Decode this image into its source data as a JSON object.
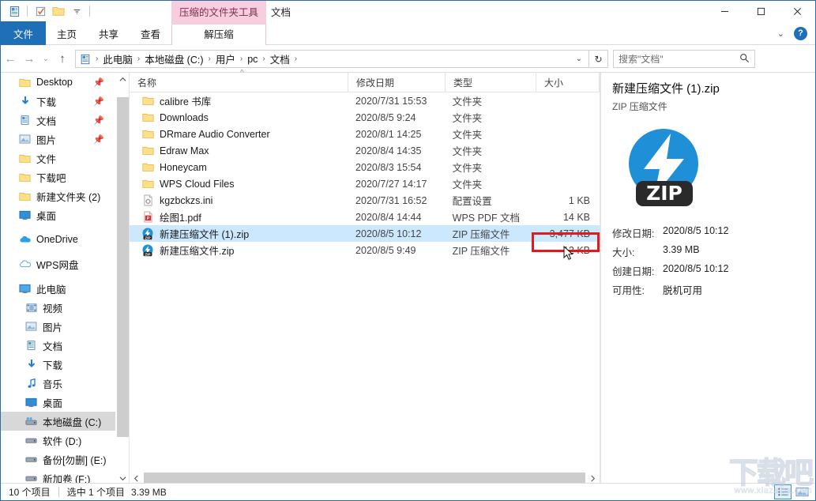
{
  "window": {
    "title": "文档",
    "contextual_tab_title": "压缩的文件夹工具",
    "minimize": "—",
    "maximize": "▢",
    "close": "✕"
  },
  "quick_access_toolbar": {
    "items": [
      {
        "name": "properties-icon",
        "glyph": "▤"
      },
      {
        "name": "new-folder-icon",
        "glyph": "▣"
      },
      {
        "name": "folder-icon",
        "glyph": "▬"
      },
      {
        "name": "customize-dropdown-icon",
        "glyph": "▼"
      }
    ]
  },
  "ribbon": {
    "tabs": [
      {
        "id": "file",
        "label": "文件"
      },
      {
        "id": "home",
        "label": "主页"
      },
      {
        "id": "share",
        "label": "共享"
      },
      {
        "id": "view",
        "label": "查看"
      },
      {
        "id": "extract",
        "label": "解压缩"
      }
    ],
    "collapse_label": "⌄",
    "help_label": "?"
  },
  "addressbar": {
    "back": "←",
    "forward": "→",
    "recent": "⌄",
    "up": "↑",
    "breadcrumbs": [
      "此电脑",
      "本地磁盘 (C:)",
      "用户",
      "pc",
      "文档"
    ],
    "separator": "›",
    "dropdown": "⌄",
    "refresh": "↻"
  },
  "search": {
    "placeholder": "搜索\"文档\"",
    "icon": "search-icon"
  },
  "sidebar": {
    "groups": [
      {
        "items": [
          {
            "label": "Desktop",
            "icon": "folder-icon",
            "pinned": true
          },
          {
            "label": "下载",
            "icon": "download-icon",
            "pinned": true
          },
          {
            "label": "文档",
            "icon": "documents-icon",
            "pinned": true
          },
          {
            "label": "图片",
            "icon": "pictures-icon",
            "pinned": true
          },
          {
            "label": "文件",
            "icon": "folder-icon",
            "pinned": false
          },
          {
            "label": "下载吧",
            "icon": "folder-icon",
            "pinned": false
          },
          {
            "label": "新建文件夹 (2)",
            "icon": "folder-icon",
            "pinned": false
          },
          {
            "label": "桌面",
            "icon": "desktop-icon",
            "pinned": false
          }
        ]
      },
      {
        "items": [
          {
            "label": "OneDrive",
            "icon": "onedrive-icon",
            "pinned": false
          }
        ]
      },
      {
        "items": [
          {
            "label": "WPS网盘",
            "icon": "wps-cloud-icon",
            "pinned": false
          }
        ]
      },
      {
        "items": [
          {
            "label": "此电脑",
            "icon": "this-pc-icon",
            "pinned": false
          },
          {
            "label": "视频",
            "icon": "videos-icon",
            "pinned": false,
            "indent": true
          },
          {
            "label": "图片",
            "icon": "pictures-icon",
            "pinned": false,
            "indent": true
          },
          {
            "label": "文档",
            "icon": "documents-icon",
            "pinned": false,
            "indent": true
          },
          {
            "label": "下载",
            "icon": "download-icon",
            "pinned": false,
            "indent": true
          },
          {
            "label": "音乐",
            "icon": "music-icon",
            "pinned": false,
            "indent": true
          },
          {
            "label": "桌面",
            "icon": "desktop-icon",
            "pinned": false,
            "indent": true
          },
          {
            "label": "本地磁盘 (C:)",
            "icon": "local-disk-icon",
            "pinned": false,
            "indent": true,
            "selected": true
          },
          {
            "label": "软件 (D:)",
            "icon": "drive-icon",
            "pinned": false,
            "indent": true
          },
          {
            "label": "备份[勿删] (E:)",
            "icon": "drive-icon",
            "pinned": false,
            "indent": true
          },
          {
            "label": "新加卷 (F:)",
            "icon": "drive-icon",
            "pinned": false,
            "indent": true
          }
        ]
      }
    ]
  },
  "filelist": {
    "columns": [
      {
        "key": "name",
        "label": "名称",
        "sorted": true,
        "sort_glyph": "^"
      },
      {
        "key": "date",
        "label": "修改日期"
      },
      {
        "key": "type",
        "label": "类型"
      },
      {
        "key": "size",
        "label": "大小"
      }
    ],
    "rows": [
      {
        "name": "calibre 书库",
        "date": "2020/7/31 15:53",
        "type": "文件夹",
        "size": "",
        "icon": "folder-icon"
      },
      {
        "name": "Downloads",
        "date": "2020/8/5 9:24",
        "type": "文件夹",
        "size": "",
        "icon": "folder-icon"
      },
      {
        "name": "DRmare Audio Converter",
        "date": "2020/8/1 14:25",
        "type": "文件夹",
        "size": "",
        "icon": "folder-icon"
      },
      {
        "name": "Edraw Max",
        "date": "2020/8/4 14:35",
        "type": "文件夹",
        "size": "",
        "icon": "folder-icon"
      },
      {
        "name": "Honeycam",
        "date": "2020/8/3 15:54",
        "type": "文件夹",
        "size": "",
        "icon": "folder-icon"
      },
      {
        "name": "WPS Cloud Files",
        "date": "2020/7/27 14:17",
        "type": "文件夹",
        "size": "",
        "icon": "folder-icon"
      },
      {
        "name": "kgzbckzs.ini",
        "date": "2020/7/31 16:52",
        "type": "配置设置",
        "size": "1 KB",
        "icon": "ini-file-icon"
      },
      {
        "name": "绘图1.pdf",
        "date": "2020/8/4 14:44",
        "type": "WPS PDF 文档",
        "size": "14 KB",
        "icon": "pdf-file-icon"
      },
      {
        "name": "新建压缩文件 (1).zip",
        "date": "2020/8/5 10:12",
        "type": "ZIP 压缩文件",
        "size": "3,477 KB",
        "icon": "zip-file-icon",
        "selected": true
      },
      {
        "name": "新建压缩文件.zip",
        "date": "2020/8/5 9:49",
        "type": "ZIP 压缩文件",
        "size": "12 KB",
        "icon": "zip-file-icon"
      }
    ]
  },
  "details": {
    "title": "新建压缩文件 (1).zip",
    "subtitle": "ZIP 压缩文件",
    "icon": "zip-file-icon",
    "icon_badge": "ZIP",
    "properties": [
      {
        "key": "修改日期:",
        "value": "2020/8/5 10:12"
      },
      {
        "key": "大小:",
        "value": "3.39 MB"
      },
      {
        "key": "创建日期:",
        "value": "2020/8/5 10:12"
      },
      {
        "key": "可用性:",
        "value": "脱机可用"
      }
    ]
  },
  "statusbar": {
    "item_count": "10 个项目",
    "selection": "选中 1 个项目",
    "selection_size": "3.39 MB",
    "views": [
      {
        "name": "details-view-button",
        "active": true
      },
      {
        "name": "large-icons-view-button",
        "active": false
      }
    ]
  },
  "watermark": {
    "big": "下载吧",
    "small": "www.xiazaiba.com"
  },
  "colors": {
    "accent": "#1e6fb8",
    "selection": "#cce8ff",
    "contextual_tab": "#f8cede",
    "annotation": "#e01b1b"
  }
}
